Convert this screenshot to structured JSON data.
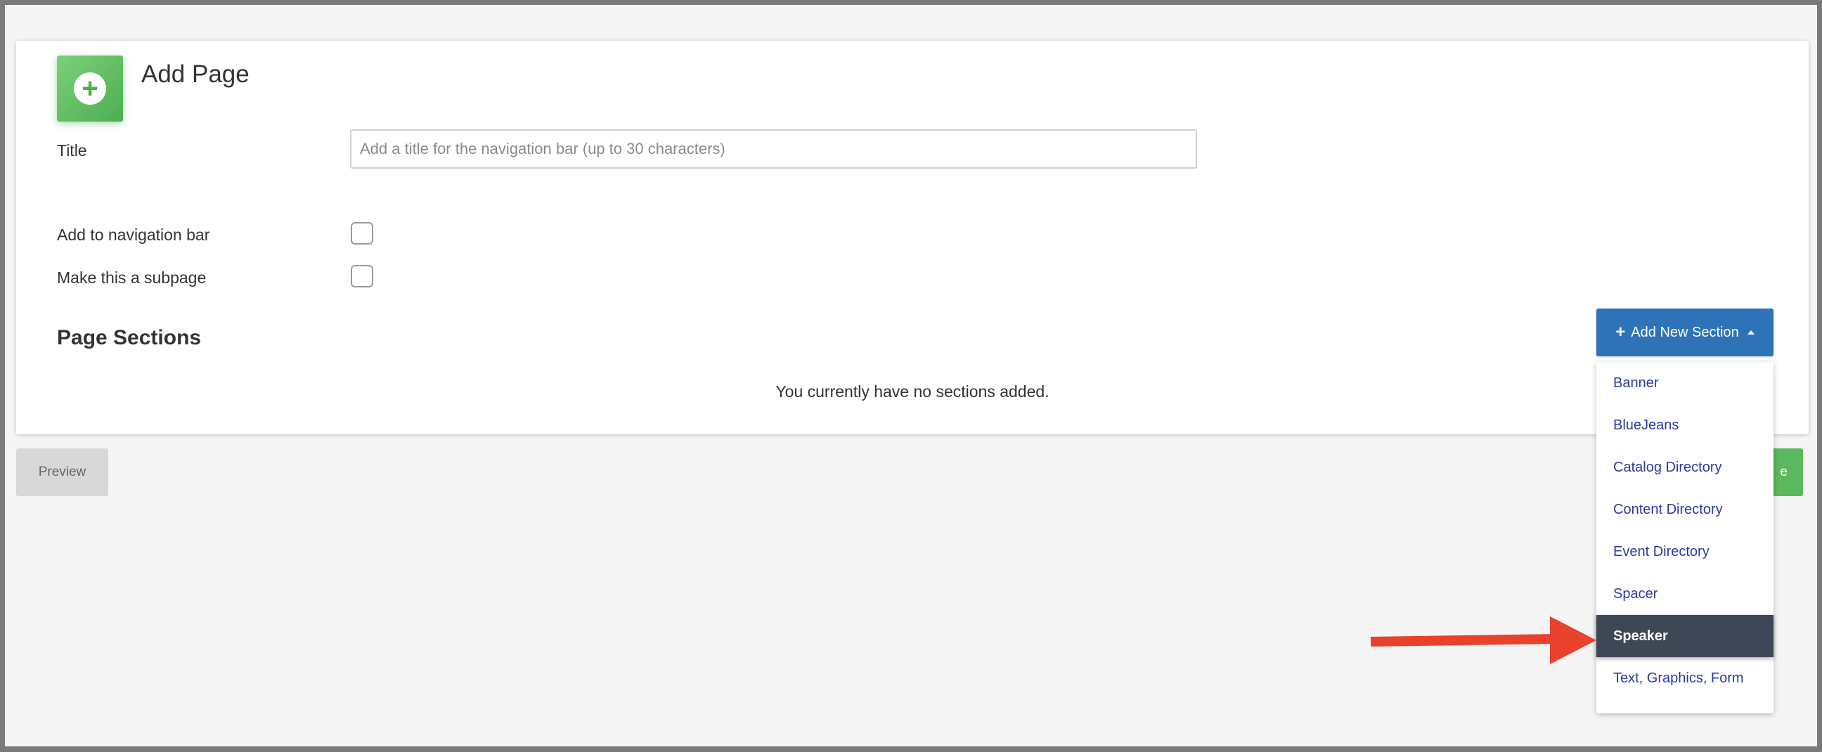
{
  "header": {
    "title": "Add Page",
    "icon": "plus-circle-icon"
  },
  "form": {
    "title_label": "Title",
    "title_placeholder": "Add a title for the navigation bar (up to 30 characters)",
    "title_value": "",
    "nav_bar_label": "Add to navigation bar",
    "nav_bar_checked": false,
    "subpage_label": "Make this a subpage",
    "subpage_checked": false
  },
  "sections": {
    "heading": "Page Sections",
    "empty_message": "You currently have no sections added.",
    "add_button_label": "Add New Section",
    "dropdown_items": [
      {
        "label": "Banner"
      },
      {
        "label": "BlueJeans"
      },
      {
        "label": "Catalog Directory"
      },
      {
        "label": "Content Directory"
      },
      {
        "label": "Event Directory"
      },
      {
        "label": "Spacer"
      },
      {
        "label": "Speaker",
        "highlighted": true
      },
      {
        "label": "Text, Graphics, Form"
      }
    ]
  },
  "footer": {
    "preview_label": "Preview",
    "save_label_visible": "e"
  },
  "colors": {
    "accent_green": "#5cb85c",
    "primary_blue": "#2e73b8",
    "highlight_dark": "#3e4756",
    "annotation_arrow": "#e8412c"
  }
}
